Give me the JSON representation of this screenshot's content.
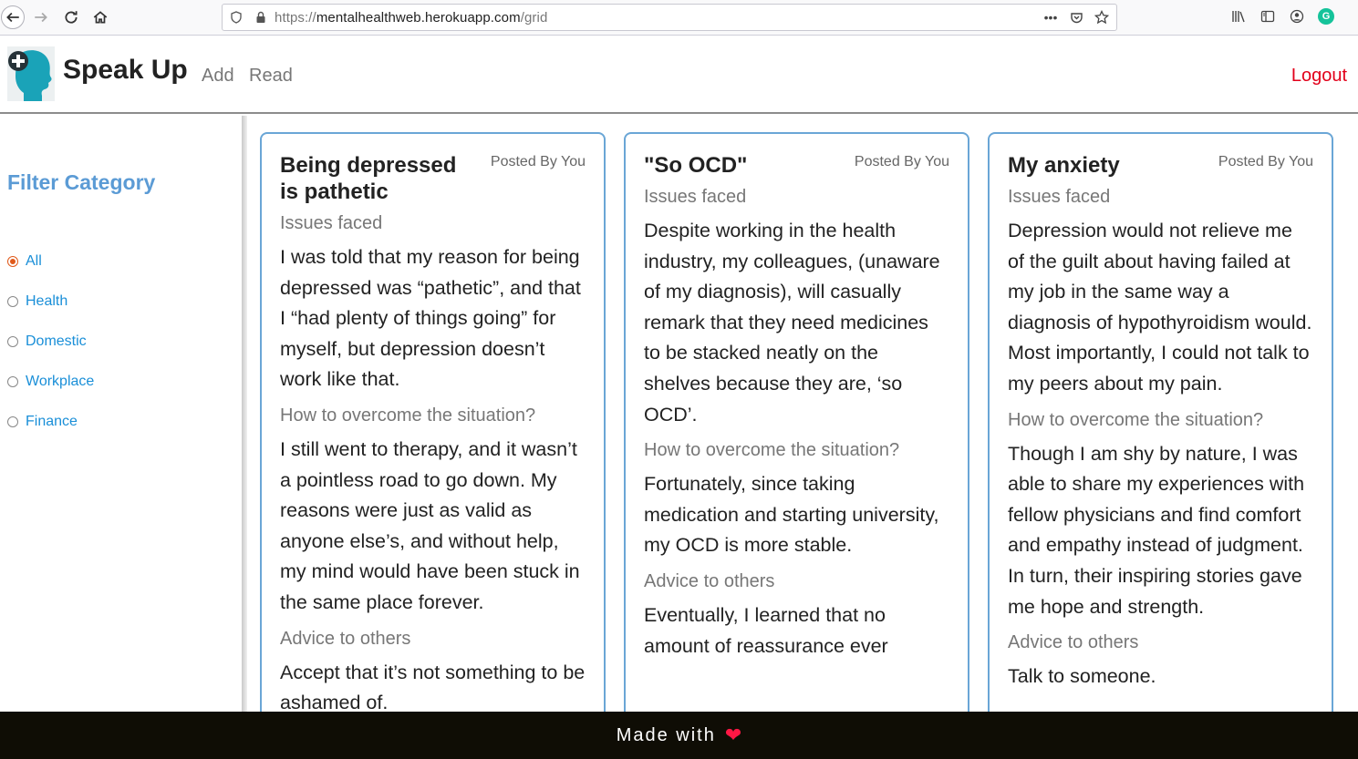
{
  "browser": {
    "url_scheme": "https://",
    "url_host": "mentalhealthweb.herokuapp.com",
    "url_path": "/grid"
  },
  "header": {
    "brand": "Speak Up",
    "nav": {
      "add": "Add",
      "read": "Read"
    },
    "logout": "Logout"
  },
  "sidebar": {
    "title": "Filter Category",
    "items": [
      {
        "label": "All",
        "checked": true
      },
      {
        "label": "Health",
        "checked": false
      },
      {
        "label": "Domestic",
        "checked": false
      },
      {
        "label": "Workplace",
        "checked": false
      },
      {
        "label": "Finance",
        "checked": false
      }
    ]
  },
  "posts": [
    {
      "title": "Being depressed is pathetic",
      "posted_by": "Posted By You",
      "issues_label": "Issues faced",
      "issues": "I was told that my reason for being depressed was “pathetic”, and that I “had plenty of things going” for myself, but depression doesn’t work like that.",
      "overcome_label": "How to overcome the situation?",
      "overcome": "I still went to therapy, and it wasn’t a pointless road to go down. My reasons were just as valid as anyone else’s, and without help, my mind would have been stuck in the same place forever.",
      "advice_label": "Advice to others",
      "advice": "Accept that it’s not something to be ashamed of."
    },
    {
      "title": "\"So OCD\"",
      "posted_by": "Posted By You",
      "issues_label": "Issues faced",
      "issues": "Despite working in the health industry, my colleagues, (unaware of my diagnosis), will casually remark that they need medicines to be stacked neatly on the shelves because they are, ‘so OCD’.",
      "overcome_label": "How to overcome the situation?",
      "overcome": "Fortunately, since taking medication and starting university, my OCD is more stable.",
      "advice_label": "Advice to others",
      "advice": "Eventually, I learned that no amount of reassurance ever"
    },
    {
      "title": "My anxiety",
      "posted_by": "Posted By You",
      "issues_label": "Issues faced",
      "issues": "Depression would not relieve me of the guilt about having failed at my job in the same way a diagnosis of hypothyroidism would. Most importantly, I could not talk to my peers about my pain.",
      "overcome_label": "How to overcome the situation?",
      "overcome": "Though I am shy by nature, I was able to share my experiences with fellow physicians and find comfort and empathy instead of judgment. In turn, their inspiring stories gave me hope and strength.",
      "advice_label": "Advice to others",
      "advice": "Talk to someone."
    }
  ],
  "footer": {
    "text": "Made with",
    "icon": "heart-icon",
    "heart_color": "#ff1744"
  },
  "colors": {
    "accent": "#5b9bd5",
    "card_border": "#6aa6d6",
    "logout": "#e2001a",
    "filter_link": "#1a8fd8"
  }
}
